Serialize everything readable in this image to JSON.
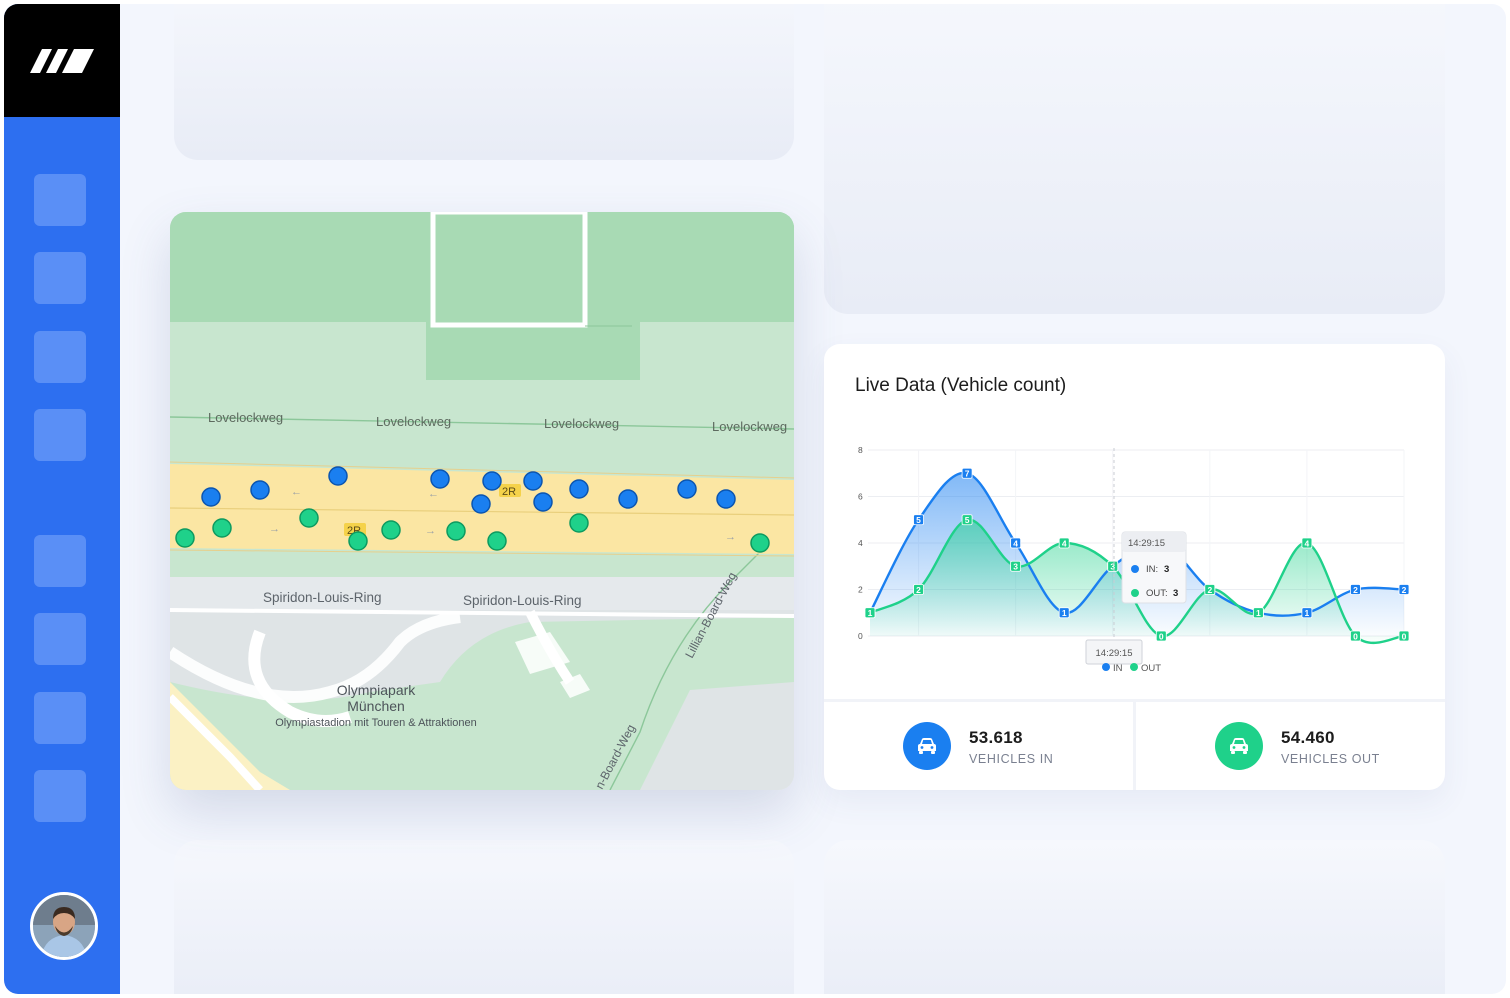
{
  "sidebar": {
    "logo": "brand-logo-icon",
    "items": [
      "nav-item-1",
      "nav-item-2",
      "nav-item-3",
      "nav-item-4",
      "nav-item-5",
      "nav-item-6",
      "nav-item-7",
      "nav-item-8"
    ],
    "accent": "#2d6ff0"
  },
  "map": {
    "streets": {
      "lovelockweg": "Lovelockweg",
      "spiridon": "Spiridon-Louis-Ring",
      "lillian": "Lillian-Board-Weg",
      "board": "n-Board-Weg"
    },
    "poi": {
      "name_line1": "Olympiapark",
      "name_line2": "München",
      "subtitle": "Olympiastadion mit Touren & Attraktionen"
    },
    "route_badge": "2R",
    "marker_colors": {
      "in": "#1a7ff0",
      "out": "#1fd18a"
    }
  },
  "live_chart": {
    "title": "Live Data (Vehicle count)",
    "tooltip": {
      "time": "14:29:15",
      "in_label": "IN:",
      "in_value": "3",
      "out_label": "OUT:",
      "out_value": "3"
    },
    "crosshair_label": "14:29:15"
  },
  "chart_data": {
    "type": "area",
    "x": [
      1,
      2,
      3,
      4,
      5,
      6,
      7,
      8,
      9,
      10,
      11,
      12
    ],
    "ylim": [
      0,
      8
    ],
    "yticks": [
      "0",
      "2",
      "4",
      "6",
      "8"
    ],
    "legend": [
      "IN",
      "OUT"
    ],
    "series": [
      {
        "name": "IN",
        "color": "#1a7ff0",
        "values": [
          1,
          5,
          7,
          4,
          1,
          3,
          4,
          2,
          1,
          1,
          2,
          2
        ]
      },
      {
        "name": "OUT",
        "color": "#1fd18a",
        "values": [
          1,
          2,
          5,
          3,
          4,
          3,
          0,
          2,
          1,
          4,
          0,
          0
        ]
      }
    ]
  },
  "stats": {
    "in": {
      "value": "53.618",
      "label": "VEHICLES IN",
      "color": "#1a7ff0",
      "icon": "car-icon"
    },
    "out": {
      "value": "54.460",
      "label": "VEHICLES OUT",
      "color": "#1fd18a",
      "icon": "car-icon"
    }
  }
}
